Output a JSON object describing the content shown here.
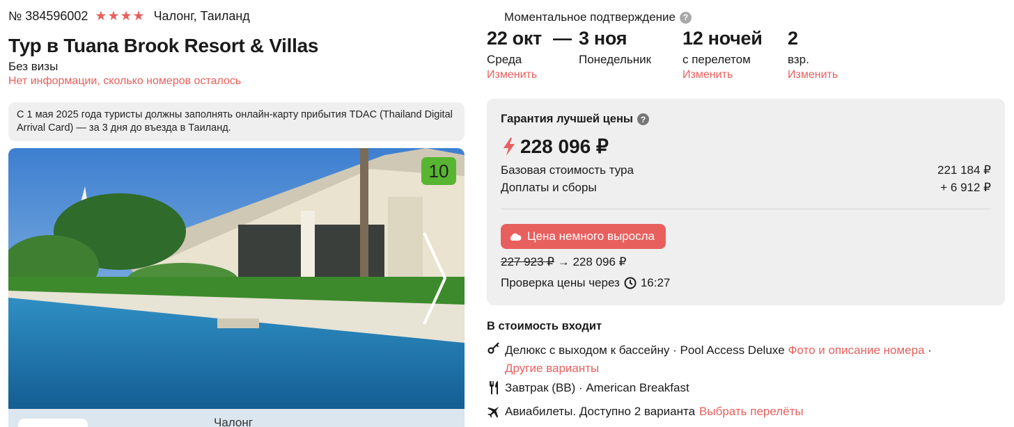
{
  "header": {
    "tour_number": "№ 384596002",
    "stars": "★★★★",
    "location": "Чалонг, Таиланд",
    "title": "Тур в Tuana Brook Resort & Villas",
    "visa": "Без визы",
    "rooms_info": "Нет информации, сколько номеров осталось"
  },
  "notice": "С 1 мая 2025 года туристы должны заполнять онлайн-карту прибытия TDAC (Thailand Digital Arrival Card) — за 3 дня до въезда в Таиланд.",
  "photo": {
    "rating": "10"
  },
  "map": {
    "city": "Чалонг"
  },
  "booking": {
    "instant_confirmation": "Моментальное подтверждение",
    "help": "?",
    "date_from": {
      "value": "22 окт",
      "weekday": "Среда",
      "change": "Изменить"
    },
    "dash": "—",
    "date_to": {
      "value": "3 ноя",
      "weekday": "Понедельник"
    },
    "nights": {
      "value": "12 ночей",
      "note": "с перелетом",
      "change": "Изменить"
    },
    "guests": {
      "value": "2",
      "note": "взр.",
      "change": "Изменить"
    }
  },
  "price": {
    "guarantee": "Гарантия лучшей цены",
    "help": "?",
    "total": "228 096 ₽",
    "base_label": "Базовая стоимость тура",
    "base_value": "221 184 ₽",
    "fees_label": "Доплаты и сборы",
    "fees_value": "+ 6 912 ₽",
    "rise_badge": "Цена немного выросла",
    "old_price": "227 923 ₽",
    "arrow": "→",
    "new_price": "228 096 ₽",
    "check_label": "Проверка цены через",
    "check_time": "16:27"
  },
  "included": {
    "heading": "В стоимость входит",
    "room": "Делюкс с выходом к бассейну · Pool Access Deluxe",
    "room_link": "Фото и описание номера",
    "room_sep": "·",
    "room_other": "Другие варианты",
    "meal": "Завтрак (BB) · American Breakfast",
    "flights": "Авиабилеты. Доступно 2 варианта",
    "flights_link": "Выбрать перелёты"
  },
  "icons": {
    "help": "question-icon",
    "total": "lightning-icon",
    "rise": "cloud-icon",
    "check": "clock-icon",
    "room": "key-icon",
    "meal": "cutlery-icon",
    "flights": "plane-icon"
  },
  "colors": {
    "accent": "#e8605e",
    "rating": "#57b531",
    "panel": "#efefef"
  }
}
